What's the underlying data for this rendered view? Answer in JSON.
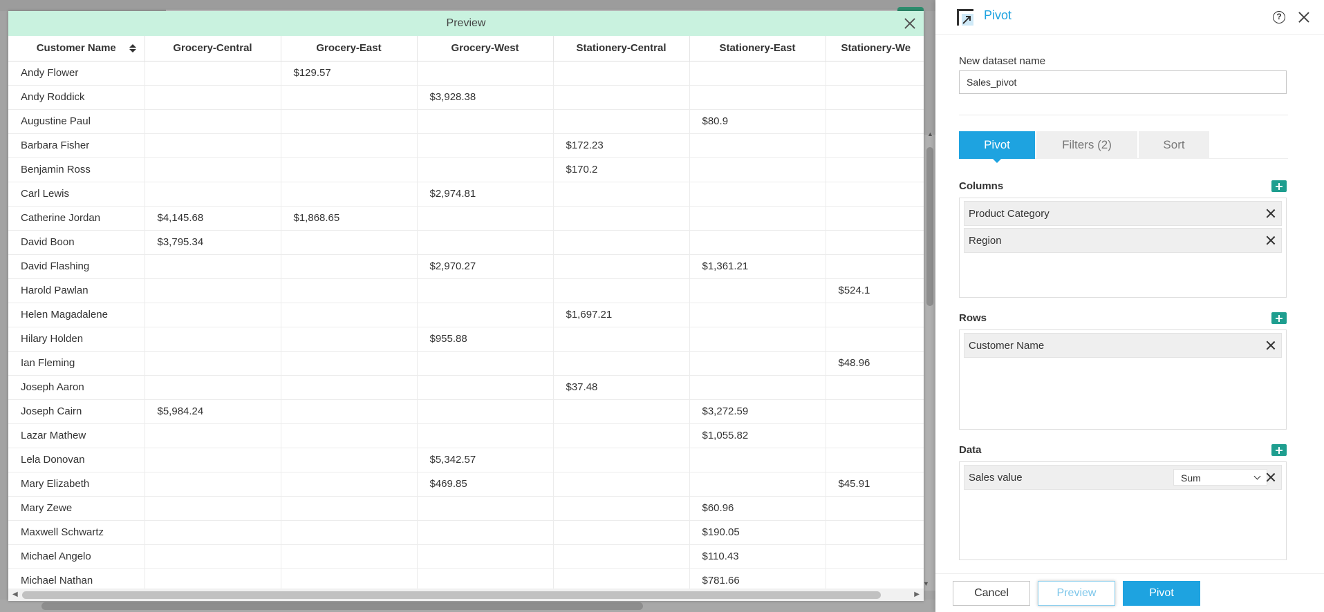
{
  "preview": {
    "title": "Preview",
    "columns": [
      "Customer Name",
      "Grocery-Central",
      "Grocery-East",
      "Grocery-West",
      "Stationery-Central",
      "Stationery-East",
      "Stationery-We"
    ],
    "rows": [
      [
        "Andy Flower",
        "",
        "$129.57",
        "",
        "",
        "",
        ""
      ],
      [
        "Andy Roddick",
        "",
        "",
        "$3,928.38",
        "",
        "",
        ""
      ],
      [
        "Augustine Paul",
        "",
        "",
        "",
        "",
        "$80.9",
        ""
      ],
      [
        "Barbara Fisher",
        "",
        "",
        "",
        "$172.23",
        "",
        ""
      ],
      [
        "Benjamin Ross",
        "",
        "",
        "",
        "$170.2",
        "",
        ""
      ],
      [
        "Carl Lewis",
        "",
        "",
        "$2,974.81",
        "",
        "",
        ""
      ],
      [
        "Catherine Jordan",
        "$4,145.68",
        "$1,868.65",
        "",
        "",
        "",
        ""
      ],
      [
        "David Boon",
        "$3,795.34",
        "",
        "",
        "",
        "",
        ""
      ],
      [
        "David Flashing",
        "",
        "",
        "$2,970.27",
        "",
        "$1,361.21",
        ""
      ],
      [
        "Harold Pawlan",
        "",
        "",
        "",
        "",
        "",
        "$524.1"
      ],
      [
        "Helen Magadalene",
        "",
        "",
        "",
        "$1,697.21",
        "",
        ""
      ],
      [
        "Hilary Holden",
        "",
        "",
        "$955.88",
        "",
        "",
        ""
      ],
      [
        "Ian Fleming",
        "",
        "",
        "",
        "",
        "",
        "$48.96"
      ],
      [
        "Joseph Aaron",
        "",
        "",
        "",
        "$37.48",
        "",
        ""
      ],
      [
        "Joseph Cairn",
        "$5,984.24",
        "",
        "",
        "",
        "$3,272.59",
        ""
      ],
      [
        "Lazar Mathew",
        "",
        "",
        "",
        "",
        "$1,055.82",
        ""
      ],
      [
        "Lela Donovan",
        "",
        "",
        "$5,342.57",
        "",
        "",
        ""
      ],
      [
        "Mary Elizabeth",
        "",
        "",
        "$469.85",
        "",
        "",
        "$45.91"
      ],
      [
        "Mary Zewe",
        "",
        "",
        "",
        "",
        "$60.96",
        ""
      ],
      [
        "Maxwell Schwartz",
        "",
        "",
        "",
        "",
        "$190.05",
        ""
      ],
      [
        "Michael Angelo",
        "",
        "",
        "",
        "",
        "$110.43",
        ""
      ],
      [
        "Michael Nathan",
        "",
        "",
        "",
        "",
        "$781.66",
        ""
      ]
    ]
  },
  "panel": {
    "title": "Pivot",
    "dataset_label": "New dataset name",
    "dataset_value": "Sales_pivot",
    "tabs": [
      {
        "label": "Pivot"
      },
      {
        "label": "Filters (2)"
      },
      {
        "label": "Sort"
      }
    ],
    "columns_label": "Columns",
    "columns": [
      "Product Category",
      "Region"
    ],
    "rows_label": "Rows",
    "rows": [
      "Customer Name"
    ],
    "data_label": "Data",
    "data_field": "Sales value",
    "data_agg": "Sum",
    "buttons": {
      "cancel": "Cancel",
      "preview": "Preview",
      "pivot": "Pivot"
    }
  },
  "colors": {
    "accent": "#1ea3e0",
    "add": "#1e9e8f",
    "header": "#c9f2df"
  }
}
